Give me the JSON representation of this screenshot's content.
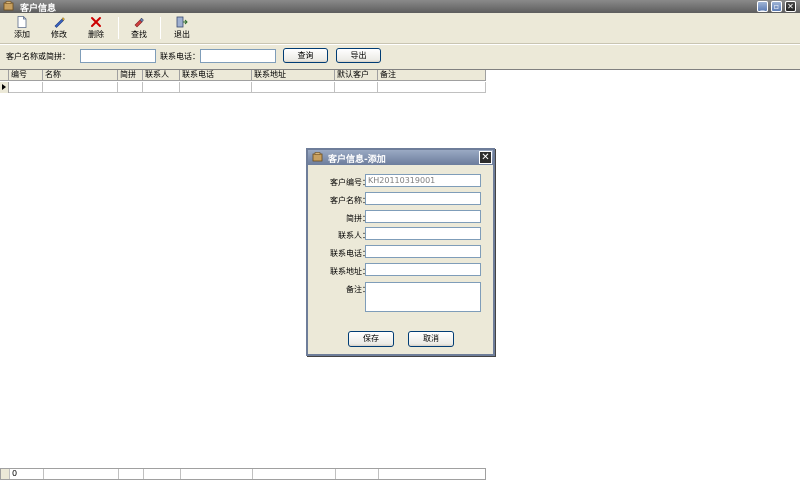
{
  "window": {
    "title": "客户信息"
  },
  "toolbar": {
    "add": "添加",
    "edit": "修改",
    "delete": "删除",
    "find": "查找",
    "exit": "退出"
  },
  "search": {
    "name_label": "客户名称或简拼：",
    "name_value": "",
    "phone_label": "联系电话：",
    "phone_value": "",
    "query_button": "查询",
    "export_button": "导出"
  },
  "grid": {
    "columns": [
      "编号",
      "名称",
      "简拼",
      "联系人",
      "联系电话",
      "联系地址",
      "默认客户",
      "备注"
    ],
    "footer_first": "0"
  },
  "dialog": {
    "title": "客户信息-添加",
    "fields": [
      {
        "label": "客户编号：",
        "value": "KH20110319001"
      },
      {
        "label": "客户名称：",
        "value": ""
      },
      {
        "label": "简拼：",
        "value": ""
      },
      {
        "label": "联系人：",
        "value": ""
      },
      {
        "label": "联系电话：",
        "value": ""
      },
      {
        "label": "联系地址：",
        "value": ""
      },
      {
        "label": "备注：",
        "value": ""
      }
    ],
    "save_button": "保存",
    "cancel_button": "取消"
  },
  "colors": {
    "titlebar": "#6e6e6e",
    "dialog_title": "#7d8caa",
    "toolbar_bg": "#ece9d8",
    "delete_icon": "#cc0000"
  },
  "icons": [
    "app-icon",
    "new-document-icon",
    "edit-pencil-icon",
    "delete-x-icon",
    "find-icon",
    "exit-door-icon"
  ]
}
